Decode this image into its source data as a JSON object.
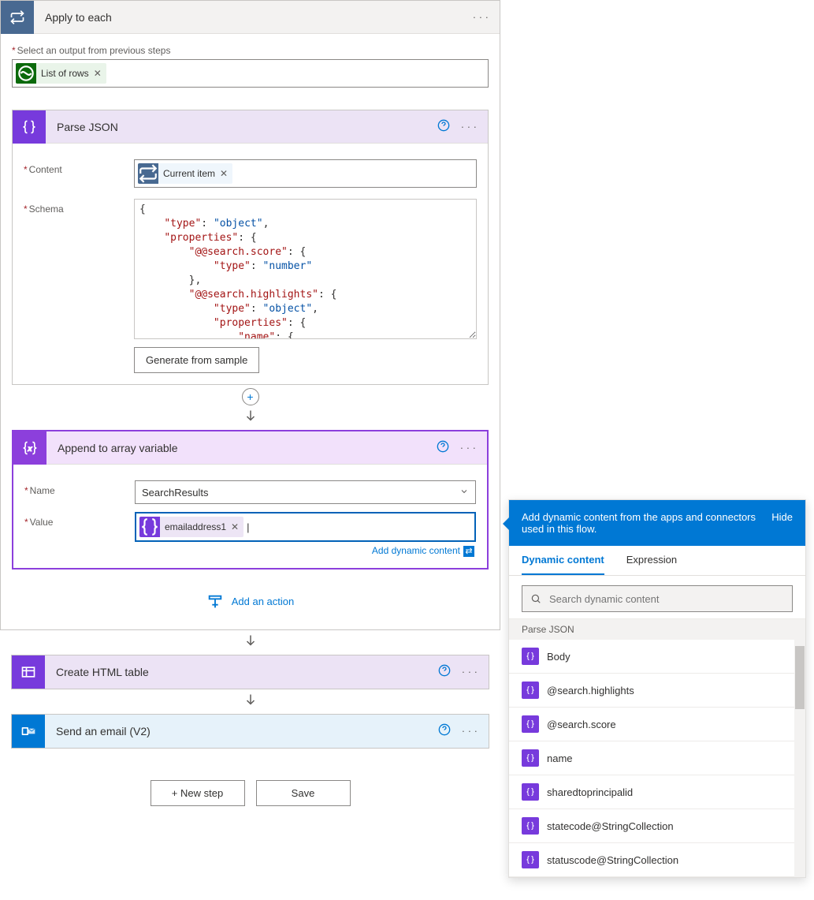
{
  "applyToEach": {
    "title": "Apply to each",
    "outputLabel": "Select an output from previous steps",
    "outputToken": "List of rows"
  },
  "parseJson": {
    "title": "Parse JSON",
    "contentLabel": "Content",
    "contentToken": "Current item",
    "schemaLabel": "Schema",
    "generateBtn": "Generate from sample"
  },
  "append": {
    "title": "Append to array variable",
    "nameLabel": "Name",
    "nameValue": "SearchResults",
    "valueLabel": "Value",
    "valueToken": "emailaddress1",
    "addDynamic": "Add dynamic content"
  },
  "addAction": "Add an action",
  "createHtml": {
    "title": "Create HTML table"
  },
  "sendEmail": {
    "title": "Send an email (V2)"
  },
  "footer": {
    "newStep": "+ New step",
    "save": "Save"
  },
  "popover": {
    "headerText": "Add dynamic content from the apps and connectors used in this flow.",
    "hide": "Hide",
    "tabDynamic": "Dynamic content",
    "tabExpression": "Expression",
    "searchPlaceholder": "Search dynamic content",
    "groupHeader": "Parse JSON",
    "items": [
      "Body",
      "@search.highlights",
      "@search.score",
      "name",
      "sharedtoprincipalid",
      "statecode@StringCollection",
      "statuscode@StringCollection"
    ]
  }
}
